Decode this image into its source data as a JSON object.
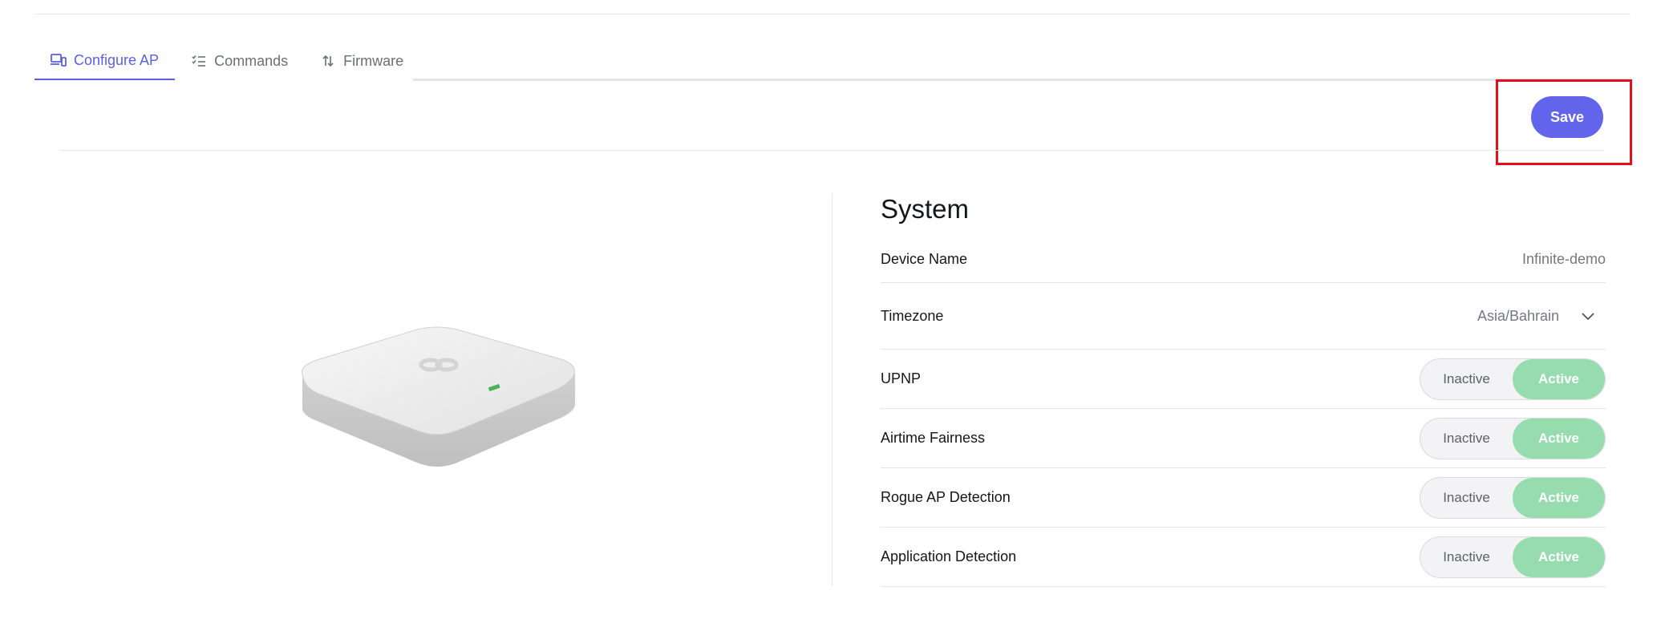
{
  "tabs": [
    {
      "label": "Configure AP",
      "icon": "devices-icon",
      "active": true
    },
    {
      "label": "Commands",
      "icon": "checklist-icon",
      "active": false
    },
    {
      "label": "Firmware",
      "icon": "sort-arrows-icon",
      "active": false
    }
  ],
  "toolbar": {
    "save_label": "Save"
  },
  "system": {
    "title": "System",
    "device_name_label": "Device Name",
    "device_name_value": "Infinite-demo",
    "timezone_label": "Timezone",
    "timezone_value": "Asia/Bahrain",
    "toggles": [
      {
        "label": "UPNP",
        "inactive": "Inactive",
        "active": "Active",
        "state": "Active"
      },
      {
        "label": "Airtime Fairness",
        "inactive": "Inactive",
        "active": "Active",
        "state": "Active"
      },
      {
        "label": "Rogue AP Detection",
        "inactive": "Inactive",
        "active": "Active",
        "state": "Active"
      },
      {
        "label": "Application Detection",
        "inactive": "Inactive",
        "active": "Active",
        "state": "Active"
      }
    ]
  },
  "colors": {
    "accent": "#6264ec",
    "active_toggle": "#97dcae",
    "highlight": "#e3101b"
  }
}
